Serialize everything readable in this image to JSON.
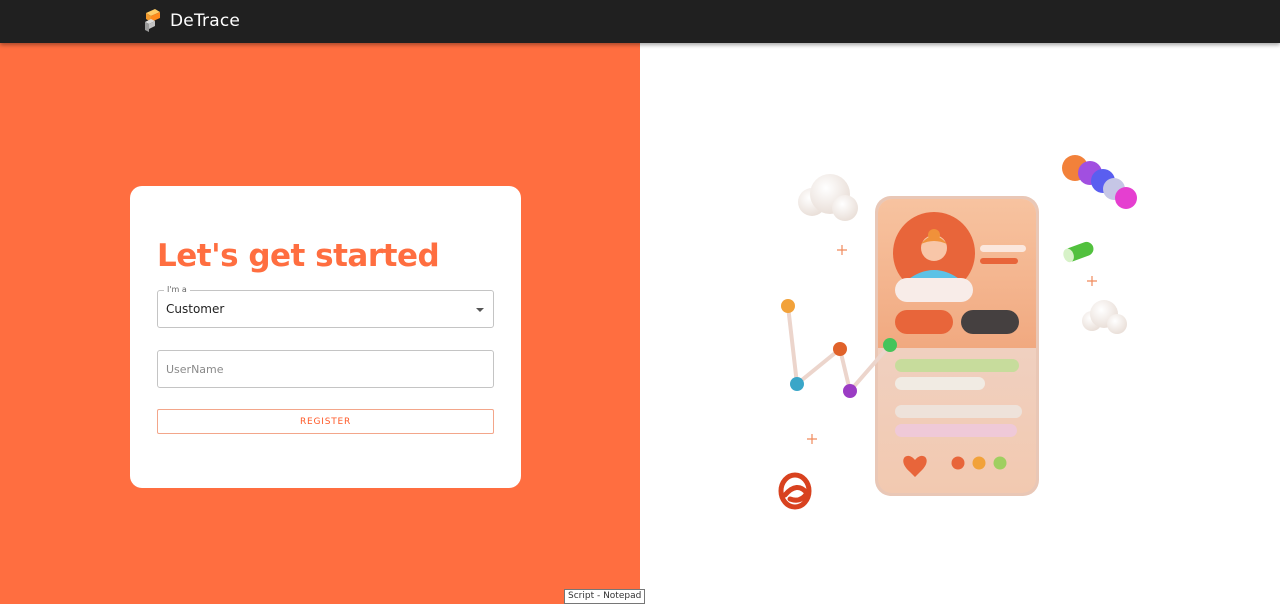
{
  "navbar": {
    "brand_name": "DeTrace",
    "logo_icon": "stacked-blocks-logo-icon"
  },
  "colors": {
    "accent": "#ff6e40",
    "navbar": "#202020",
    "card": "#ffffff"
  },
  "form": {
    "title": "Let's get started",
    "role_select": {
      "label": "I'm a",
      "value": "Customer",
      "icon": "arrow-drop-down-icon"
    },
    "username": {
      "placeholder": "UserName",
      "value": ""
    },
    "register_label": "REGISTER"
  },
  "illustration": {
    "subject": "3d-phone-profile-illustration"
  },
  "taskbar_tooltip": "Script - Notepad"
}
